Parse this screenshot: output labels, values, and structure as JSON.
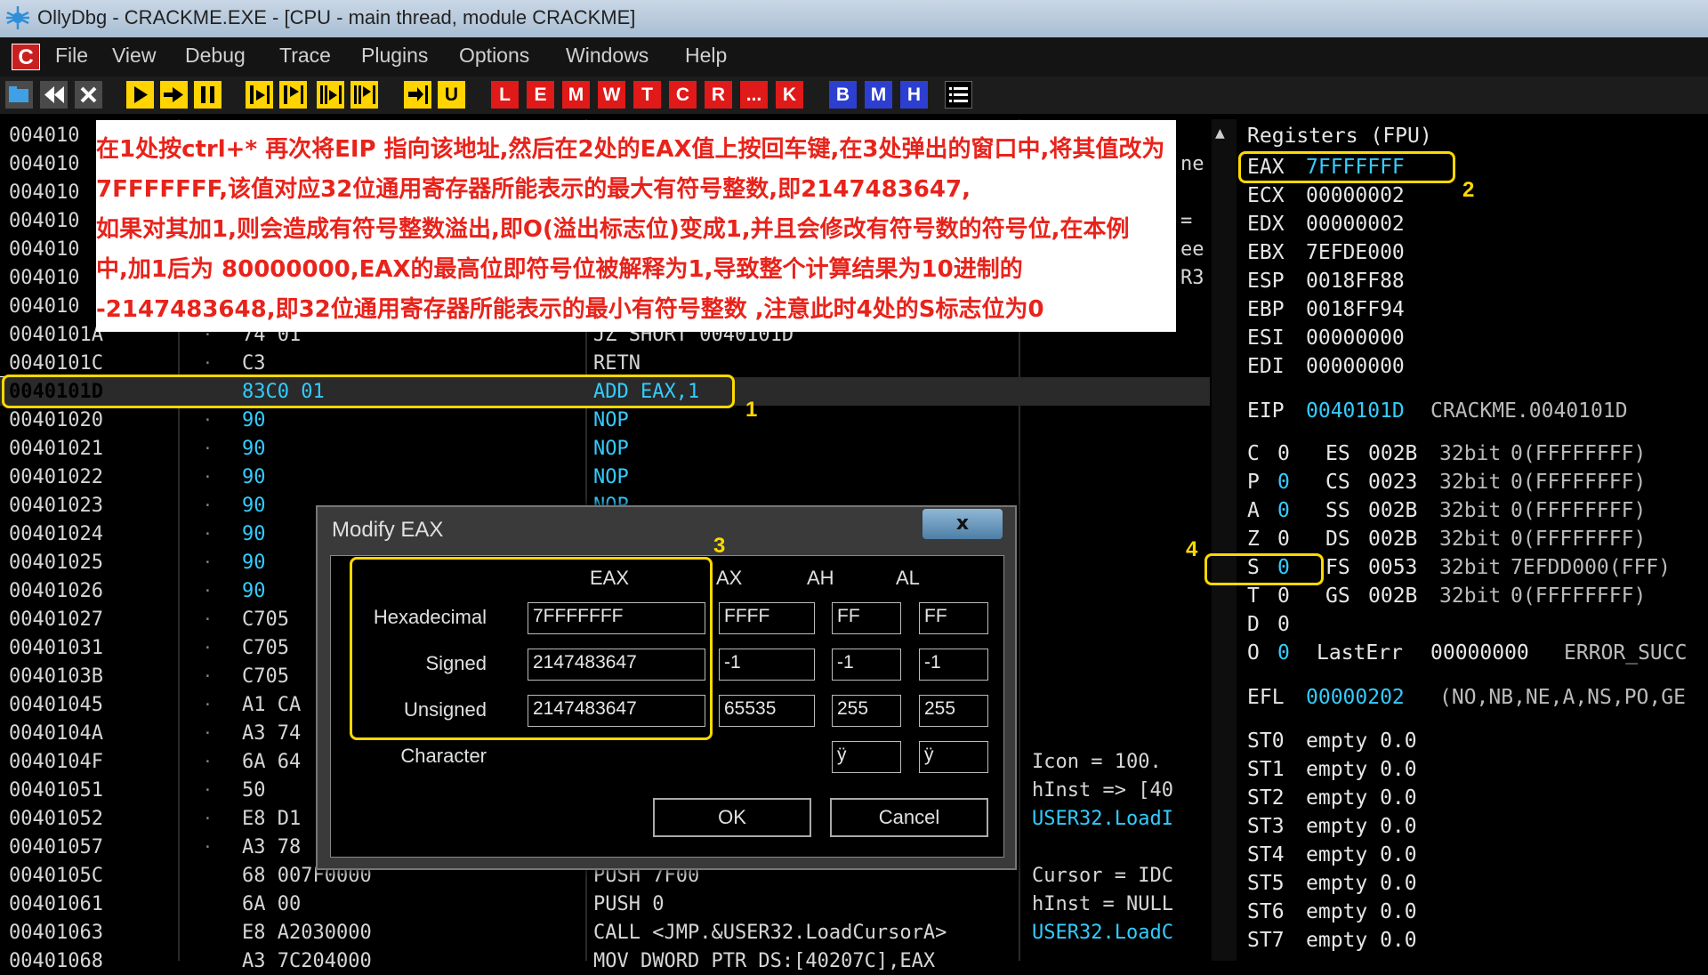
{
  "window": {
    "title": "OllyDbg - CRACKME.EXE - [CPU - main thread, module CRACKME]",
    "icon": "bug-icon"
  },
  "menu": [
    "File",
    "View",
    "Debug",
    "Trace",
    "Plugins",
    "Options",
    "Windows",
    "Help"
  ],
  "menu_logo": "C",
  "toolbar": {
    "letter_buttons": [
      "L",
      "E",
      "M",
      "W",
      "T",
      "C",
      "R",
      "...",
      "K"
    ],
    "view_buttons": [
      "B",
      "M",
      "H"
    ],
    "icons": [
      "open-icon",
      "restart-icon",
      "close-icon",
      "run-icon",
      "step-run-icon",
      "pause-icon",
      "step-into-icon",
      "step-over-icon",
      "trace-into-icon",
      "trace-over-icon",
      "execute-till-return-icon",
      "go-to-user-code-icon",
      "list-icon"
    ]
  },
  "disasm": {
    "rows": [
      {
        "addr": "004010",
        "hex": "",
        "asm": "",
        "cmt": ""
      },
      {
        "addr": "004010",
        "hex": "",
        "asm": "",
        "cmt": "ne"
      },
      {
        "addr": "004010",
        "hex": "",
        "asm": "",
        "cmt": ""
      },
      {
        "addr": "004010",
        "hex": "",
        "asm": "",
        "cmt": "="
      },
      {
        "addr": "004010",
        "hex": "",
        "asm": "",
        "cmt": "ee"
      },
      {
        "addr": "004010",
        "hex": "",
        "asm": "",
        "cmt": "R3"
      },
      {
        "addr": "004010",
        "hex": "",
        "asm": "",
        "cmt": ""
      },
      {
        "addr": "0040101A",
        "hex": "74 01",
        "asm": "JZ SHORT 0040101D",
        "cmt": ""
      },
      {
        "addr": "0040101C",
        "hex": "C3",
        "asm": "RETN",
        "cmt": ""
      },
      {
        "addr": "0040101D",
        "hex": "83C0 01",
        "asm": "ADD EAX,1",
        "cmt": ""
      },
      {
        "addr": "00401020",
        "hex": "90",
        "asm": "NOP",
        "cmt": ""
      },
      {
        "addr": "00401021",
        "hex": "90",
        "asm": "NOP",
        "cmt": ""
      },
      {
        "addr": "00401022",
        "hex": "90",
        "asm": "NOP",
        "cmt": ""
      },
      {
        "addr": "00401023",
        "hex": "90",
        "asm": "NOP",
        "cmt": ""
      },
      {
        "addr": "00401024",
        "hex": "90",
        "asm": "NOP",
        "cmt": ""
      },
      {
        "addr": "00401025",
        "hex": "90",
        "asm": "",
        "cmt": ""
      },
      {
        "addr": "00401026",
        "hex": "90",
        "asm": "",
        "cmt": ""
      },
      {
        "addr": "00401027",
        "hex": "C705",
        "asm": "",
        "cmt": ""
      },
      {
        "addr": "00401031",
        "hex": "C705",
        "asm": "",
        "cmt": ""
      },
      {
        "addr": "0040103B",
        "hex": "C705",
        "asm": "",
        "cmt": ""
      },
      {
        "addr": "00401045",
        "hex": "A1 CA",
        "asm": "",
        "cmt": ""
      },
      {
        "addr": "0040104A",
        "hex": "A3 74",
        "asm": "",
        "cmt": ""
      },
      {
        "addr": "0040104F",
        "hex": "6A 64",
        "asm": "",
        "cmt": "Icon = 100."
      },
      {
        "addr": "00401051",
        "hex": "50",
        "asm": "",
        "cmt": "hInst => [40"
      },
      {
        "addr": "00401052",
        "hex": "E8 D1",
        "asm": "",
        "cmt": "USER32.LoadI"
      },
      {
        "addr": "00401057",
        "hex": "A3 78",
        "asm": "",
        "cmt": ""
      },
      {
        "addr": "0040105C",
        "hex": "68 007F0000",
        "asm": "PUSH 7F00",
        "cmt": "Cursor = IDC"
      },
      {
        "addr": "00401061",
        "hex": "6A 00",
        "asm": "PUSH 0",
        "cmt": "hInst = NULL"
      },
      {
        "addr": "00401063",
        "hex": "E8 A2030000",
        "asm": "CALL <JMP.&USER32.LoadCursorA>",
        "cmt": "USER32.LoadC"
      },
      {
        "addr": "00401068",
        "hex": "A3 7C204000",
        "asm": "MOV DWORD PTR DS:[40207C],EAX",
        "cmt": ""
      }
    ]
  },
  "registers": {
    "header": "Registers (FPU)",
    "gp": [
      {
        "name": "EAX",
        "value": "7FFFFFFF"
      },
      {
        "name": "ECX",
        "value": "00000002"
      },
      {
        "name": "EDX",
        "value": "00000002"
      },
      {
        "name": "EBX",
        "value": "7EFDE000"
      },
      {
        "name": "ESP",
        "value": "0018FF88"
      },
      {
        "name": "EBP",
        "value": "0018FF94"
      },
      {
        "name": "ESI",
        "value": "00000000"
      },
      {
        "name": "EDI",
        "value": "00000000"
      }
    ],
    "eip": {
      "name": "EIP",
      "value": "0040101D",
      "desc": "CRACKME.0040101D"
    },
    "flags": [
      {
        "flag": "C",
        "val": "0",
        "seg": "ES",
        "sel": "002B",
        "bits": "32bit",
        "range": "0(FFFFFFFF)"
      },
      {
        "flag": "P",
        "val": "0",
        "seg": "CS",
        "sel": "0023",
        "bits": "32bit",
        "range": "0(FFFFFFFF)"
      },
      {
        "flag": "A",
        "val": "0",
        "seg": "SS",
        "sel": "002B",
        "bits": "32bit",
        "range": "0(FFFFFFFF)"
      },
      {
        "flag": "Z",
        "val": "0",
        "seg": "DS",
        "sel": "002B",
        "bits": "32bit",
        "range": "0(FFFFFFFF)"
      },
      {
        "flag": "S",
        "val": "0",
        "seg": "FS",
        "sel": "0053",
        "bits": "32bit",
        "range": "7EFDD000(FFF)"
      },
      {
        "flag": "T",
        "val": "0",
        "seg": "GS",
        "sel": "002B",
        "bits": "32bit",
        "range": "0(FFFFFFFF)"
      },
      {
        "flag": "D",
        "val": "0",
        "seg": "",
        "sel": "",
        "bits": "",
        "range": ""
      },
      {
        "flag": "O",
        "val": "0",
        "seg": "LastErr",
        "sel": "00000000",
        "bits": "ERROR_SUCC",
        "range": ""
      }
    ],
    "efl": {
      "name": "EFL",
      "value": "00000202",
      "desc": "(NO,NB,NE,A,NS,PO,GE"
    },
    "fpu": [
      {
        "name": "ST0",
        "value": "empty 0.0"
      },
      {
        "name": "ST1",
        "value": "empty 0.0"
      },
      {
        "name": "ST2",
        "value": "empty 0.0"
      },
      {
        "name": "ST3",
        "value": "empty 0.0"
      },
      {
        "name": "ST4",
        "value": "empty 0.0"
      },
      {
        "name": "ST5",
        "value": "empty 0.0"
      },
      {
        "name": "ST6",
        "value": "empty 0.0"
      },
      {
        "name": "ST7",
        "value": "empty 0.0"
      }
    ]
  },
  "annotation": {
    "lines": [
      "在1处按ctrl+* 再次将EIP 指向该地址,然后在2处的EAX值上按回车键,在3处弹出的窗口中,将其值改为",
      "7FFFFFFF,该值对应32位通用寄存器所能表示的最大有符号整数,即2147483647,",
      "如果对其加1,则会造成有符号整数溢出,即O(溢出标志位)变成1,并且会修改有符号数的符号位,在本例",
      "中,加1后为 80000000,EAX的最高位即符号位被解释为1,导致整个计算结果为10进制的",
      "-2147483648,即32位通用寄存器所能表示的最小有符号整数 ,注意此时4处的S标志位为0"
    ],
    "markers": [
      "1",
      "2",
      "3",
      "4"
    ]
  },
  "dialog": {
    "title": "Modify EAX",
    "close": "x",
    "columns": [
      "EAX",
      "AX",
      "AH",
      "AL"
    ],
    "row_labels": [
      "Hexadecimal",
      "Signed",
      "Unsigned",
      "Character"
    ],
    "hex": [
      "7FFFFFFF",
      "FFFF",
      "FF",
      "FF"
    ],
    "signed": [
      "2147483647",
      "-1",
      "-1",
      "-1"
    ],
    "unsigned": [
      "2147483647",
      "65535",
      "255",
      "255"
    ],
    "character": [
      "ÿ",
      "ÿ"
    ],
    "ok_label": "OK",
    "cancel_label": "Cancel"
  }
}
